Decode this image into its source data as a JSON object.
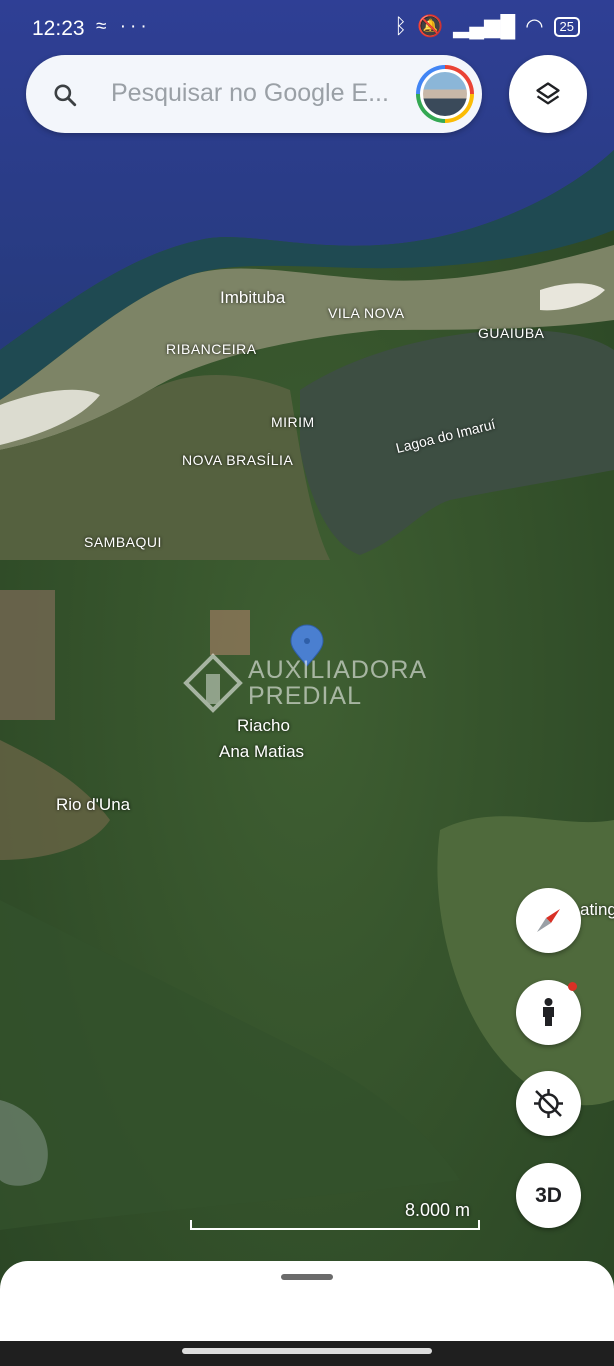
{
  "status_bar": {
    "time": "12:23",
    "left_icons": "≈ ···",
    "battery": "25"
  },
  "search": {
    "placeholder": "Pesquisar no Google E..."
  },
  "map_labels": {
    "imbituba": "Imbituba",
    "vila_nova": "VILA NOVA",
    "guaiuba": "GUAIUBA",
    "ribanceira": "RIBANCEIRA",
    "mirim": "MIRIM",
    "lagoa": "Lagoa do Imaruí",
    "nova_brasilia": "NOVA BRASÍLIA",
    "sambaqui": "SAMBAQUI",
    "riacho_line1": "Riacho",
    "riacho_line2": "Ana Matias",
    "rio_duna": "Rio d'Una",
    "edge_partial": "ating"
  },
  "watermark": {
    "line1": "AUXILIADORA",
    "line2": "PREDIAL"
  },
  "scale": {
    "label": "8.000 m"
  },
  "controls": {
    "three_d_label": "3D"
  },
  "colors": {
    "water": "#2a3f8f",
    "land": "#34502c",
    "accent_red": "#d93025",
    "pin_blue": "#4a7fd0"
  }
}
